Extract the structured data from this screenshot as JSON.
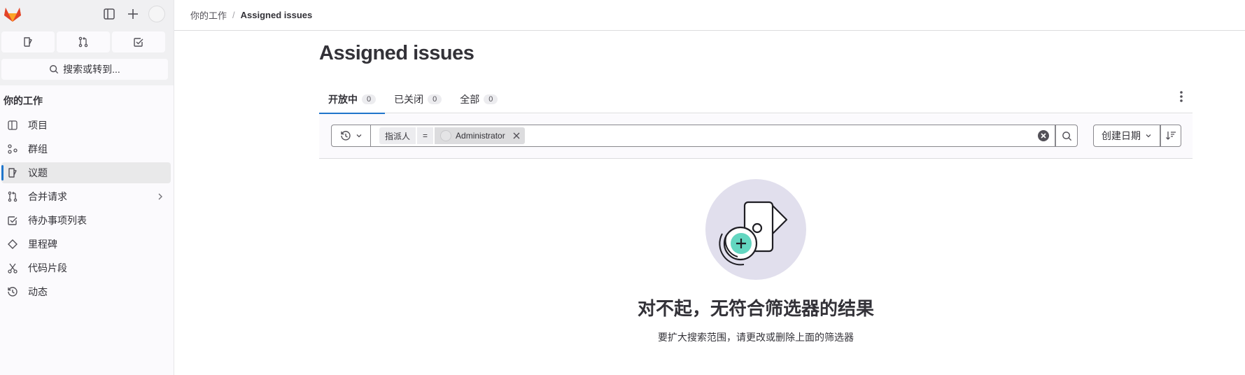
{
  "sidebar": {
    "search_label": "搜索或转到...",
    "section_title": "你的工作",
    "quick_actions": [
      "issues-icon",
      "merge-request-icon",
      "todo-icon"
    ],
    "items": [
      {
        "label": "项目",
        "icon": "project-icon",
        "active": false
      },
      {
        "label": "群组",
        "icon": "group-icon",
        "active": false
      },
      {
        "label": "议题",
        "icon": "issues-icon",
        "active": true
      },
      {
        "label": "合并请求",
        "icon": "merge-request-icon",
        "active": false,
        "has_submenu": true
      },
      {
        "label": "待办事项列表",
        "icon": "todo-icon",
        "active": false
      },
      {
        "label": "里程碑",
        "icon": "milestone-icon",
        "active": false
      },
      {
        "label": "代码片段",
        "icon": "snippet-icon",
        "active": false
      },
      {
        "label": "动态",
        "icon": "history-icon",
        "active": false
      }
    ]
  },
  "breadcrumb": {
    "parent": "你的工作",
    "separator": "/",
    "current": "Assigned issues"
  },
  "page": {
    "title": "Assigned issues"
  },
  "tabs": [
    {
      "label": "开放中",
      "count": "0",
      "active": true
    },
    {
      "label": "已关闭",
      "count": "0",
      "active": false
    },
    {
      "label": "全部",
      "count": "0",
      "active": false
    }
  ],
  "filter": {
    "token_key": "指派人",
    "token_operator": "=",
    "token_value": "Administrator",
    "sort_label": "创建日期"
  },
  "empty_state": {
    "title": "对不起，无符合筛选器的结果",
    "description": "要扩大搜索范围，请更改或删除上面的筛选器"
  },
  "colors": {
    "accent": "#1f75cb",
    "illustration_bg": "#e1dfed",
    "illustration_plus": "#63d6c0"
  }
}
